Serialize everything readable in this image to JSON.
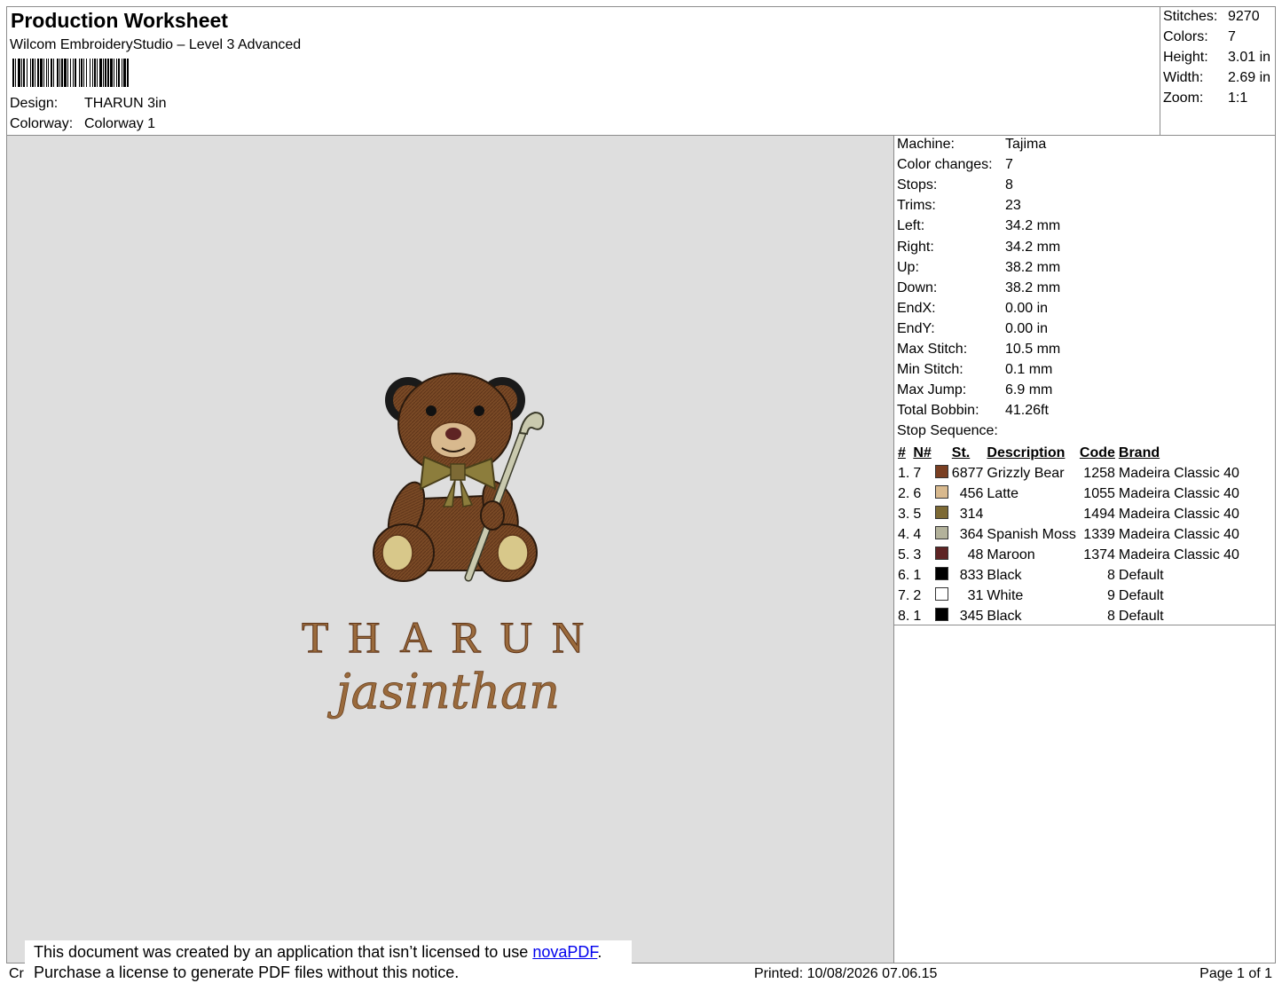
{
  "header": {
    "title": "Production Worksheet",
    "software": "Wilcom EmbroideryStudio – Level 3 Advanced",
    "design_label": "Design:",
    "design_value": "THARUN 3in",
    "colorway_label": "Colorway:",
    "colorway_value": "Colorway 1"
  },
  "summary": [
    {
      "label": "Stitches:",
      "value": "9270"
    },
    {
      "label": "Colors:",
      "value": "7"
    },
    {
      "label": "Height:",
      "value": "3.01 in"
    },
    {
      "label": "Width:",
      "value": "2.69 in"
    },
    {
      "label": "Zoom:",
      "value": "1:1"
    }
  ],
  "details": [
    {
      "label": "Machine:",
      "value": "Tajima"
    },
    {
      "label": "Color changes:",
      "value": "7"
    },
    {
      "label": "Stops:",
      "value": "8"
    },
    {
      "label": "Trims:",
      "value": "23"
    },
    {
      "label": "Left:",
      "value": "34.2 mm"
    },
    {
      "label": "Right:",
      "value": "34.2 mm"
    },
    {
      "label": "Up:",
      "value": "38.2 mm"
    },
    {
      "label": "Down:",
      "value": "38.2 mm"
    },
    {
      "label": "EndX:",
      "value": "0.00 in"
    },
    {
      "label": "EndY:",
      "value": "0.00 in"
    },
    {
      "label": "Max Stitch:",
      "value": "10.5 mm"
    },
    {
      "label": "Min Stitch:",
      "value": "0.1 mm"
    },
    {
      "label": "Max Jump:",
      "value": "6.9 mm"
    },
    {
      "label": "Total Bobbin:",
      "value": "41.26ft"
    }
  ],
  "stop_sequence": {
    "title": "Stop Sequence:",
    "headers": [
      "#",
      "N#",
      "St.",
      "Description",
      "Code",
      "Brand"
    ],
    "rows": [
      {
        "idx": "1.",
        "n": "7",
        "color": "#7a3f22",
        "st": "6877",
        "desc": "Grizzly Bear",
        "code": "1258",
        "brand": "Madeira Classic 40"
      },
      {
        "idx": "2.",
        "n": "6",
        "color": "#d8b98e",
        "st": "456",
        "desc": "Latte",
        "code": "1055",
        "brand": "Madeira Classic 40"
      },
      {
        "idx": "3.",
        "n": "5",
        "color": "#7d6a35",
        "st": "314",
        "desc": "",
        "code": "1494",
        "brand": "Madeira Classic 40"
      },
      {
        "idx": "4.",
        "n": "4",
        "color": "#b3b29b",
        "st": "364",
        "desc": "Spanish Moss",
        "code": "1339",
        "brand": "Madeira Classic 40"
      },
      {
        "idx": "5.",
        "n": "3",
        "color": "#5e2424",
        "st": "48",
        "desc": "Maroon",
        "code": "1374",
        "brand": "Madeira Classic 40"
      },
      {
        "idx": "6.",
        "n": "1",
        "color": "#000000",
        "st": "833",
        "desc": "Black",
        "code": "8",
        "brand": "Default"
      },
      {
        "idx": "7.",
        "n": "2",
        "color": "#ffffff",
        "st": "31",
        "desc": "White",
        "code": "9",
        "brand": "Default"
      },
      {
        "idx": "8.",
        "n": "1",
        "color": "#000000",
        "st": "345",
        "desc": "Black",
        "code": "8",
        "brand": "Default"
      }
    ]
  },
  "design_art": {
    "name_text": "THARUN",
    "script_text": "jasinthan"
  },
  "footer": {
    "left_partial": "Cr",
    "printed": "Printed: 10/08/2026 07.06.15",
    "page": "Page 1 of 1"
  },
  "notice": {
    "line1_prefix": "This document was created by an application that isn’t licensed to use ",
    "link": "novaPDF",
    "line1_suffix": ".",
    "line2": "Purchase a license to generate PDF files without this notice."
  }
}
